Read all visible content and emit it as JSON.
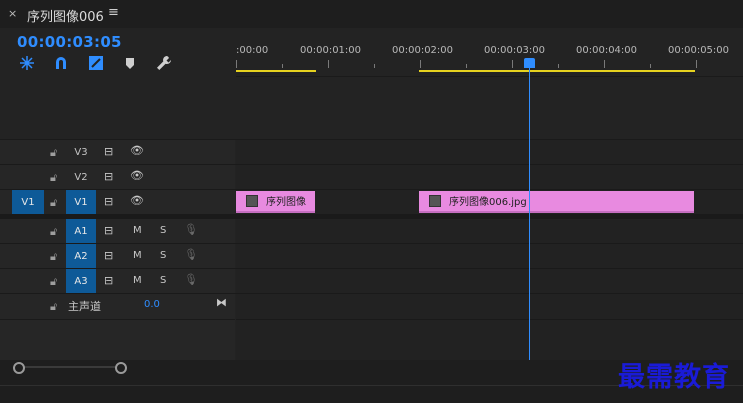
{
  "tab": {
    "close_glyph": "×",
    "title": "序列图像006",
    "menu_glyph": "≡"
  },
  "timecode": "00:00:03:05",
  "tools": [
    "snap-icon",
    "linked-selection-icon",
    "add-marker-icon",
    "marker-icon",
    "wrench-icon"
  ],
  "ruler": {
    "labels": [
      ":00:00",
      "00:00:01:00",
      "00:00:02:00",
      "00:00:03:00",
      "00:00:04:00",
      "00:00:05:00"
    ]
  },
  "tracks": {
    "video": [
      {
        "name": "V3",
        "source": ""
      },
      {
        "name": "V2",
        "source": ""
      },
      {
        "name": "V1",
        "source": "V1"
      }
    ],
    "audio": [
      {
        "name": "A1",
        "m": "M",
        "s": "S"
      },
      {
        "name": "A2",
        "m": "M",
        "s": "S"
      },
      {
        "name": "A3",
        "m": "M",
        "s": "S"
      }
    ],
    "master": {
      "label": "主声道",
      "value": "0.0"
    }
  },
  "clips": [
    {
      "label": "序列图像",
      "track": "V1"
    },
    {
      "label": "序列图像006.jpg",
      "track": "V1"
    }
  ],
  "icons": {
    "lock": "🔓︎",
    "eye": "👁︎",
    "film": "⊟",
    "mic": "🎙︎",
    "trim": "⧓"
  },
  "watermark": "最需教育",
  "colors": {
    "accent": "#2f8dff",
    "selected_track": "#0e5a98",
    "clip": "#e88ae0",
    "inout": "#e6d21f"
  }
}
